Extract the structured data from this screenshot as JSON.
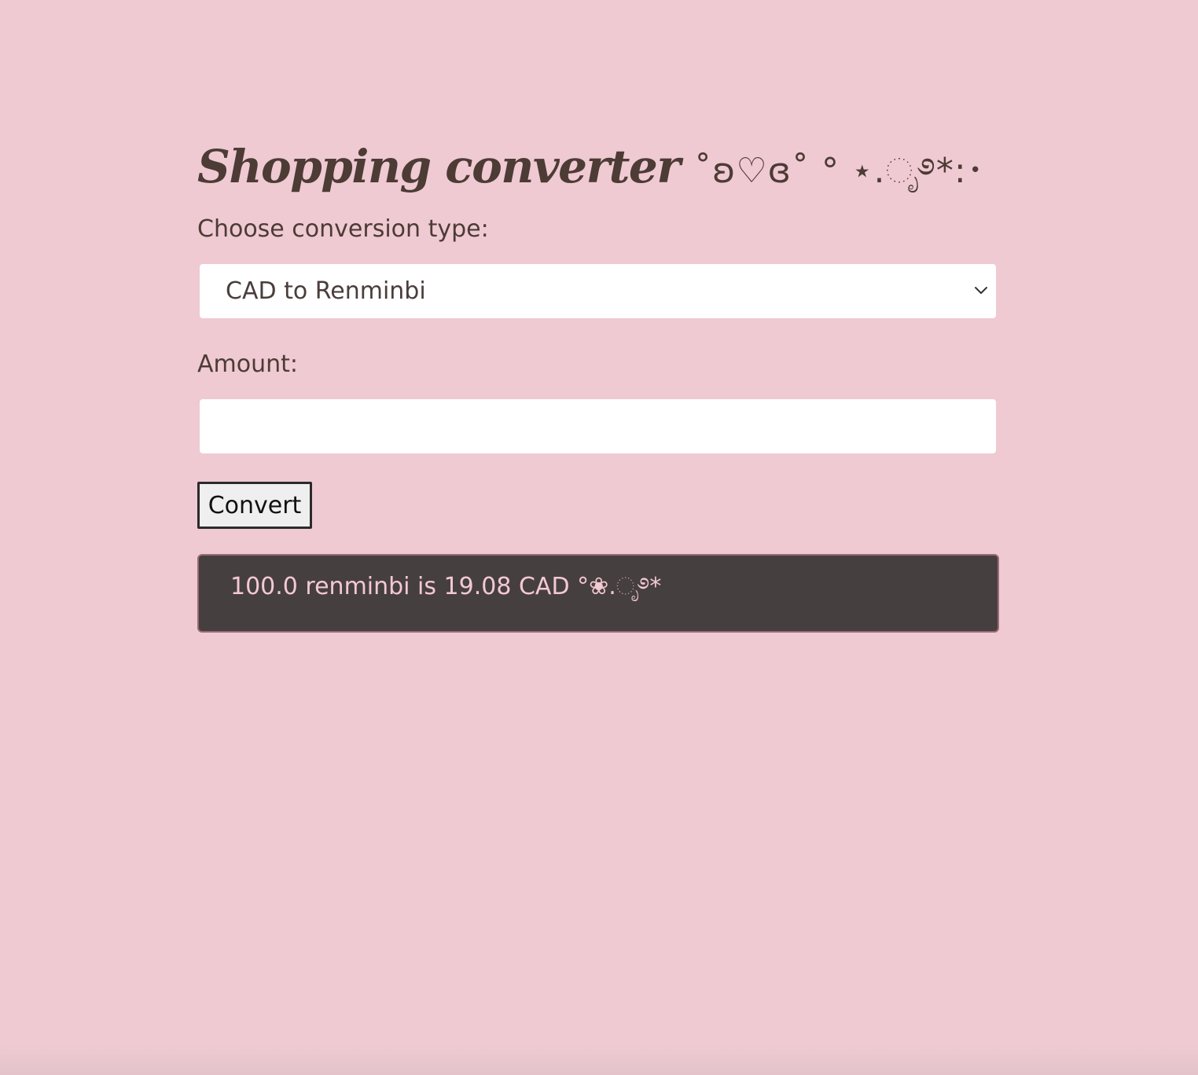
{
  "page": {
    "title": "Shopping converter",
    "title_decoration": "˚ʚ♡ɞ˚ ° ⋆.ೃ࿔*:･"
  },
  "form": {
    "conversion_label": "Choose conversion type:",
    "conversion_selected": "CAD to Renminbi",
    "amount_label": "Amount:",
    "amount_value": "",
    "amount_placeholder": "",
    "convert_button_label": "Convert"
  },
  "result": {
    "text": "100.0 renminbi is 19.08 CAD °❀.ೃ࿔*"
  },
  "colors": {
    "background": "#efcad2",
    "text_dark": "#4d3b35",
    "result_background": "#463f3f",
    "result_text": "#f3c9d3"
  },
  "icons": {
    "select_indicator": "chevron-down-icon"
  }
}
